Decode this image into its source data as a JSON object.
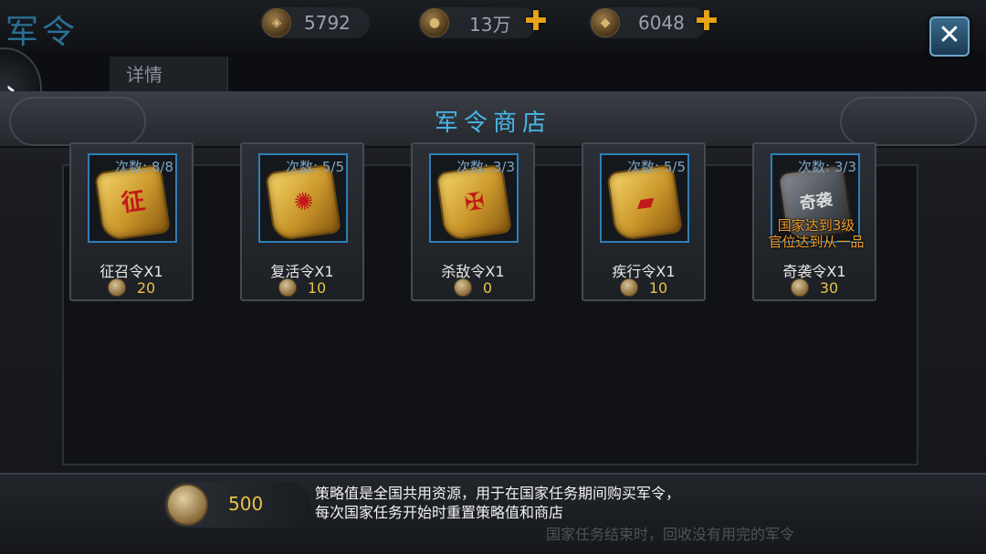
{
  "header": {
    "page_title": "军令",
    "resources": [
      {
        "icon": "strategy-coin-icon",
        "value": "5792"
      },
      {
        "icon": "copper-coin-icon",
        "value": "13万"
      },
      {
        "icon": "gold-ingot-icon",
        "value": "6048"
      }
    ],
    "close_label": "✕"
  },
  "detail_tab": "详情",
  "shop": {
    "title": "军令商店",
    "items": [
      {
        "name": "征召令X1",
        "count": "次数: 8/8",
        "price": "20",
        "glyph": "征",
        "style": "gold"
      },
      {
        "name": "复活令X1",
        "count": "次数: 5/5",
        "price": "10",
        "glyph": "✺",
        "style": "gold"
      },
      {
        "name": "杀敌令X1",
        "count": "次数: 3/3",
        "price": "0",
        "glyph": "✠",
        "style": "gold"
      },
      {
        "name": "疾行令X1",
        "count": "次数: 5/5",
        "price": "10",
        "glyph": "▰",
        "style": "gold"
      },
      {
        "name": "奇袭令X1",
        "count": "次数: 3/3",
        "price": "30",
        "glyph": "奇袭",
        "style": "dark",
        "lock_line1": "国家达到3级",
        "lock_line2": "官位达到从一品"
      }
    ]
  },
  "footer": {
    "balance": "500",
    "desc_line1": "策略值是全国共用资源，用于在国家任务期间购买军令，",
    "desc_line2": "每次国家任务开始时重置策略值和商店",
    "underlay": "国家任务结束时，回收没有用完的军令"
  }
}
